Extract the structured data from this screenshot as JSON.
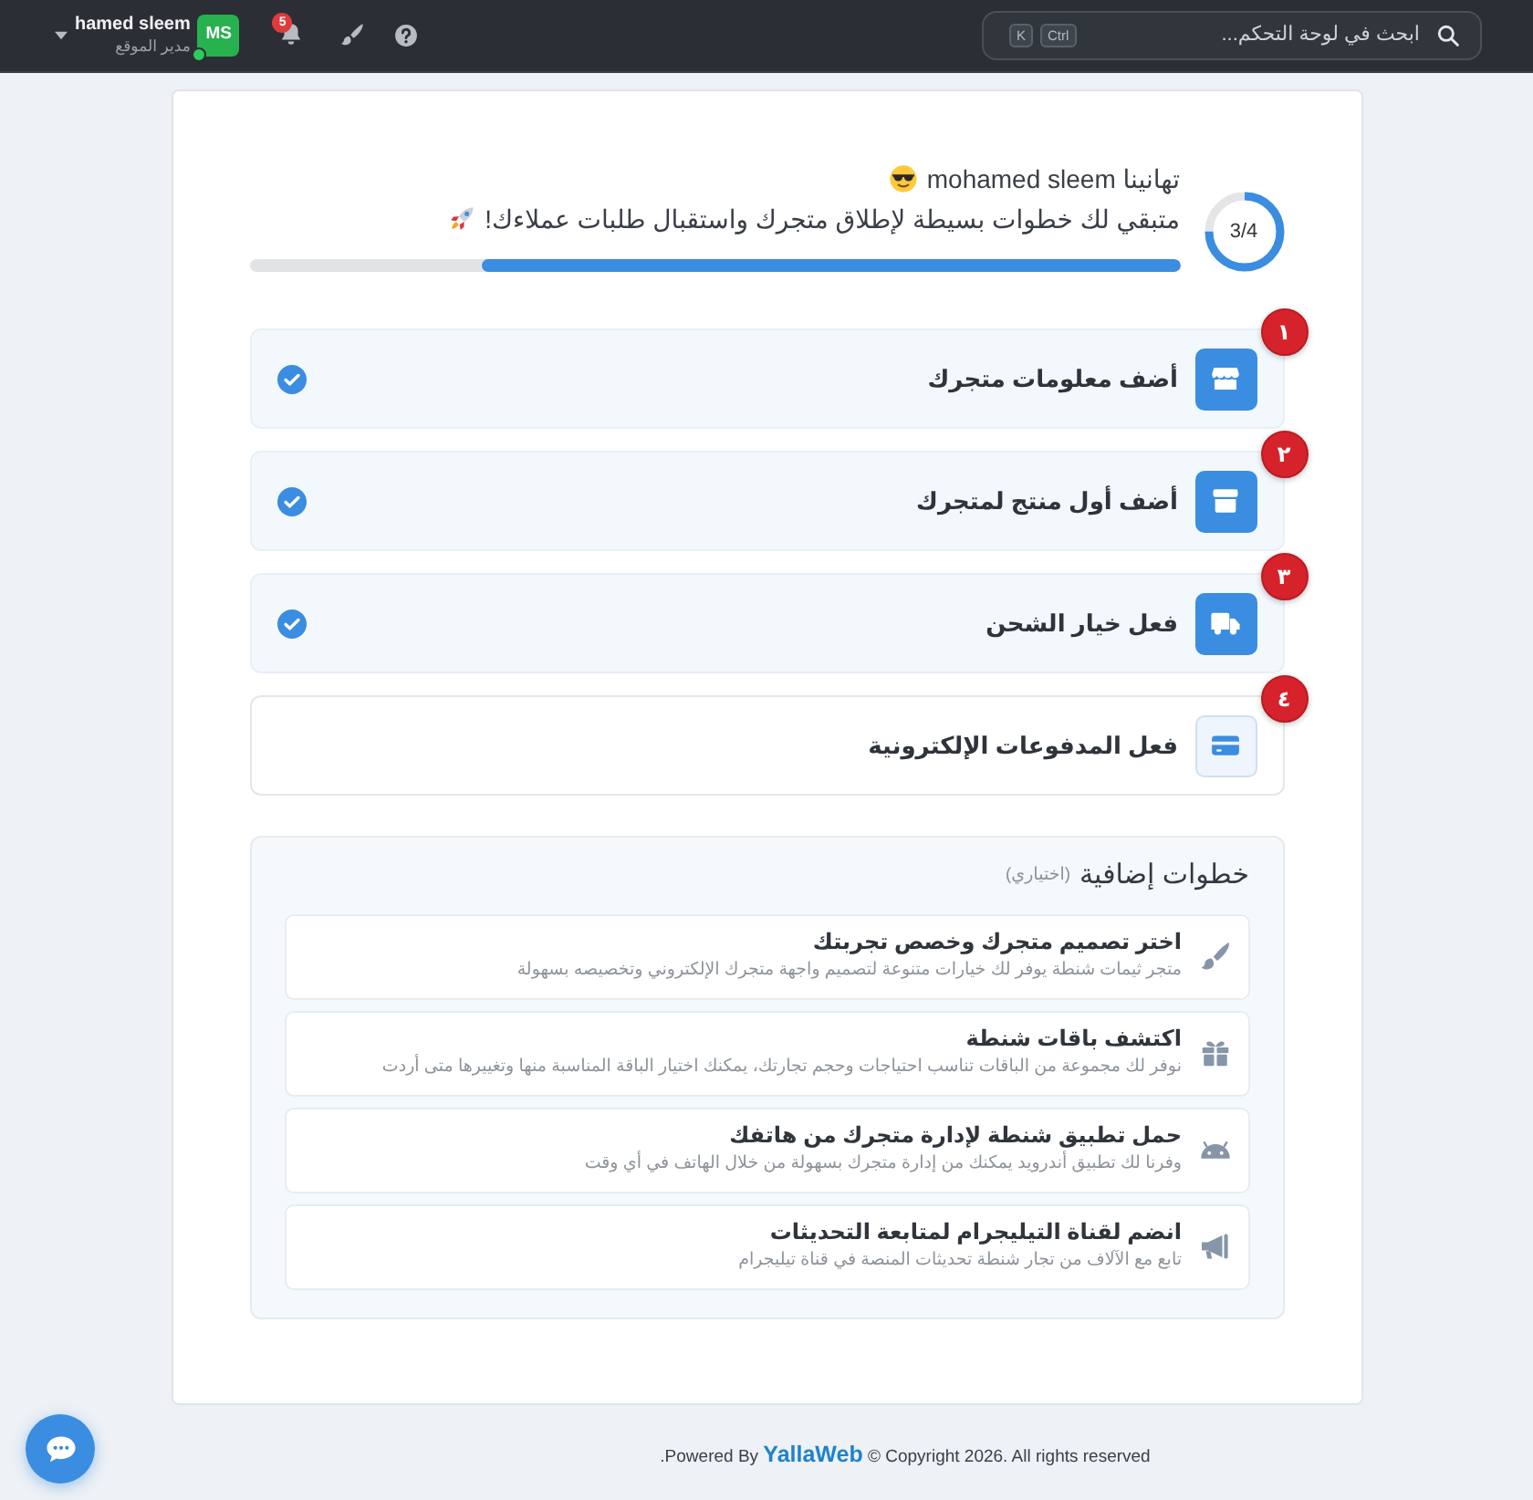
{
  "topbar": {
    "search": {
      "placeholder": "ابحث في لوحة التحكم...",
      "keys": [
        "Ctrl",
        "K"
      ]
    },
    "notifications": {
      "count": "5"
    },
    "user": {
      "initials": "MS",
      "online": true,
      "name": "hamed sleem",
      "role": "مدير الموقع"
    }
  },
  "welcome": {
    "greeting": "تهانينا mohamed sleem",
    "message": "متبقي لك خطوات بسيطة لإطلاق متجرك واستقبال طلبات عملاءك!",
    "ring": {
      "text": "3/4",
      "level": 0.75
    },
    "progress": {
      "level": 0.75
    }
  },
  "steps": [
    {
      "number": "١",
      "title": "أضف معلومات متجرك",
      "done": true
    },
    {
      "number": "٢",
      "title": "أضف أول منتج لمتجرك",
      "done": true
    },
    {
      "number": "٣",
      "title": "فعل خيار الشحن",
      "done": true
    },
    {
      "number": "٤",
      "title": "فعل المدفوعات الإلكترونية",
      "done": false
    }
  ],
  "extra_steps": {
    "title": "خطوات إضافية",
    "note": "(اختياري)",
    "items": [
      {
        "title": "اختر تصميم متجرك وخصص تجربتك",
        "description": "متجر ثيمات شنطة يوفر لك خيارات متنوعة لتصميم واجهة متجرك الإلكتروني وتخصيصه بسهولة"
      },
      {
        "title": "اكتشف باقات شنطة",
        "description": "نوفر لك مجموعة من الباقات تناسب احتياجات وحجم تجارتك، يمكنك اختيار الباقة المناسبة منها وتغييرها متى أردت"
      },
      {
        "title": "حمل تطبيق شنطة لإدارة متجرك من هاتفك",
        "description": "وفرنا لك تطبيق أندرويد يمكنك من إدارة متجرك بسهولة من خلال الهاتف في أي وقت"
      },
      {
        "title": "انضم لقناة التيليجرام لمتابعة التحديثات",
        "description": "تابع مع الآلاف من تجار شنطة تحديثات المنصة في قناة تيليجرام"
      }
    ]
  },
  "footer": {
    "prefix": ".Powered By",
    "brand": "YallaWeb",
    "suffix": "© Copyright 2026. All rights reserved"
  }
}
